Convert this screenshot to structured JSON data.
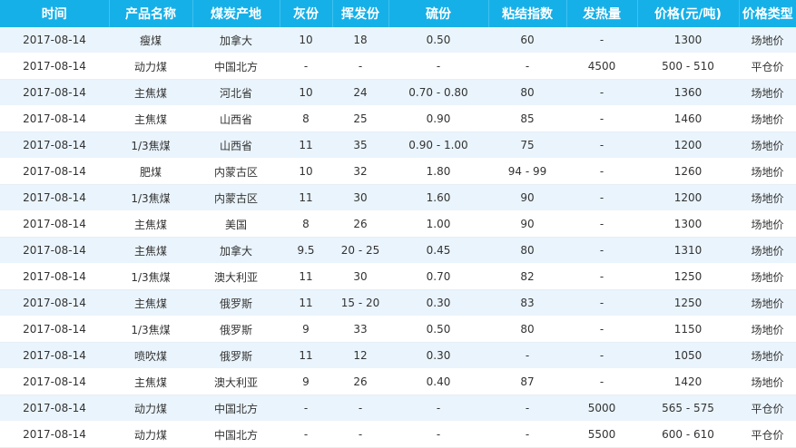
{
  "headers": [
    "时间",
    "产品名称",
    "煤炭产地",
    "灰份",
    "挥发份",
    "硫份",
    "粘结指数",
    "发热量",
    "价格(元/吨)",
    "价格类型"
  ],
  "rows": [
    [
      "2017-08-14",
      "瘦煤",
      "加拿大",
      "10",
      "18",
      "0.50",
      "60",
      "-",
      "1300",
      "场地价"
    ],
    [
      "2017-08-14",
      "动力煤",
      "中国北方",
      "-",
      "-",
      "-",
      "-",
      "4500",
      "500 - 510",
      "平仓价"
    ],
    [
      "2017-08-14",
      "主焦煤",
      "河北省",
      "10",
      "24",
      "0.70 - 0.80",
      "80",
      "-",
      "1360",
      "场地价"
    ],
    [
      "2017-08-14",
      "主焦煤",
      "山西省",
      "8",
      "25",
      "0.90",
      "85",
      "-",
      "1460",
      "场地价"
    ],
    [
      "2017-08-14",
      "1/3焦煤",
      "山西省",
      "11",
      "35",
      "0.90 - 1.00",
      "75",
      "-",
      "1200",
      "场地价"
    ],
    [
      "2017-08-14",
      "肥煤",
      "内蒙古区",
      "10",
      "32",
      "1.80",
      "94 - 99",
      "-",
      "1260",
      "场地价"
    ],
    [
      "2017-08-14",
      "1/3焦煤",
      "内蒙古区",
      "11",
      "30",
      "1.60",
      "90",
      "-",
      "1200",
      "场地价"
    ],
    [
      "2017-08-14",
      "主焦煤",
      "美国",
      "8",
      "26",
      "1.00",
      "90",
      "-",
      "1300",
      "场地价"
    ],
    [
      "2017-08-14",
      "主焦煤",
      "加拿大",
      "9.5",
      "20 - 25",
      "0.45",
      "80",
      "-",
      "1310",
      "场地价"
    ],
    [
      "2017-08-14",
      "1/3焦煤",
      "澳大利亚",
      "11",
      "30",
      "0.70",
      "82",
      "-",
      "1250",
      "场地价"
    ],
    [
      "2017-08-14",
      "主焦煤",
      "俄罗斯",
      "11",
      "15 - 20",
      "0.30",
      "83",
      "-",
      "1250",
      "场地价"
    ],
    [
      "2017-08-14",
      "1/3焦煤",
      "俄罗斯",
      "9",
      "33",
      "0.50",
      "80",
      "-",
      "1150",
      "场地价"
    ],
    [
      "2017-08-14",
      "喷吹煤",
      "俄罗斯",
      "11",
      "12",
      "0.30",
      "-",
      "-",
      "1050",
      "场地价"
    ],
    [
      "2017-08-14",
      "主焦煤",
      "澳大利亚",
      "9",
      "26",
      "0.40",
      "87",
      "-",
      "1420",
      "场地价"
    ],
    [
      "2017-08-14",
      "动力煤",
      "中国北方",
      "-",
      "-",
      "-",
      "-",
      "5000",
      "565 - 575",
      "平仓价"
    ],
    [
      "2017-08-14",
      "动力煤",
      "中国北方",
      "-",
      "-",
      "-",
      "-",
      "5500",
      "600 - 610",
      "平仓价"
    ]
  ],
  "colors": {
    "header_bg": "#16b0e8",
    "header_text": "#ffffff",
    "row_alt_bg": "#eaf4fc",
    "row_bg": "#ffffff",
    "cell_text": "#333333"
  }
}
